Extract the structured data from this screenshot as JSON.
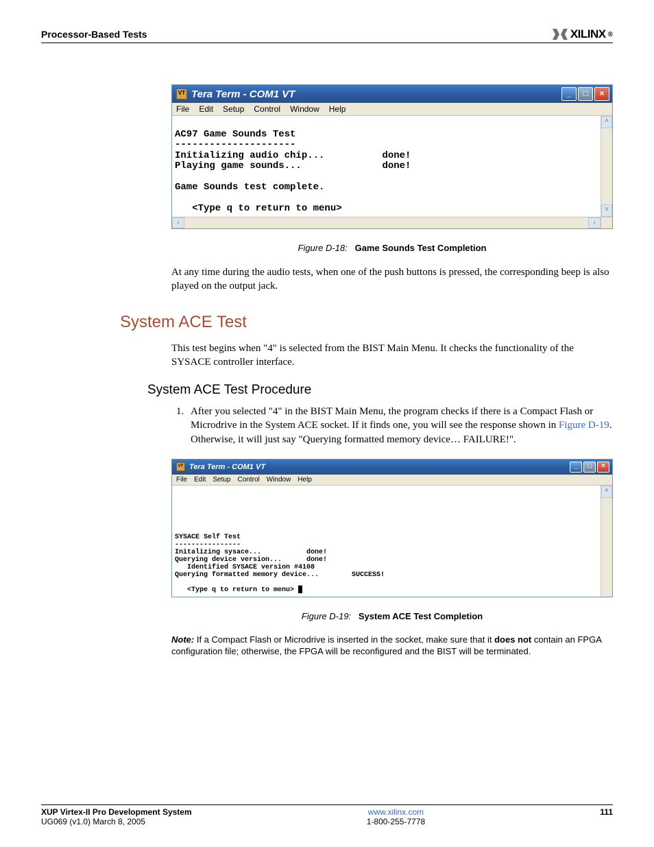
{
  "header": {
    "section_title": "Processor-Based Tests",
    "logo_text": "XILINX",
    "logo_reg": "®"
  },
  "term1": {
    "title": "Tera Term - COM1 VT",
    "menus": [
      "File",
      "Edit",
      "Setup",
      "Control",
      "Window",
      "Help"
    ],
    "body": "AC97 Game Sounds Test\n---------------------\nInitializing audio chip...          done!\nPlaying game sounds...              done!\n\nGame Sounds test complete.\n\n   <Type q to return to menu>"
  },
  "fig1": {
    "prefix": "Figure D-18:",
    "title": "Game Sounds Test Completion"
  },
  "p1": "At any time during the audio tests, when one of the push buttons is pressed, the corresponding beep is also played on the output jack.",
  "h2": "System ACE Test",
  "p2": "This test begins when \"4\" is selected from the BIST Main Menu. It checks the functionality of the SYSACE controller interface.",
  "h3": "System ACE Test Procedure",
  "li1_a": "After you selected \"4\" in the BIST Main Menu, the program checks if there is a Compact Flash or Microdrive in the System ACE socket. If it finds one, you will see the response shown in ",
  "li1_link": "Figure D-19",
  "li1_b": ". Otherwise, it will just say \"Querying formatted memory device… FAILURE!\".",
  "term2": {
    "title": "Tera Term - COM1 VT",
    "menus": [
      "File",
      "Edit",
      "Setup",
      "Control",
      "Window",
      "Help"
    ],
    "body": "SYSACE Self Test\n----------------\nInitalizing sysace...           done!\nQuerying device version...      done!\n   Identified SYSACE version #4108\nQuerying formatted memory device...        SUCCESS!\n\n   <Type q to return to menu> █"
  },
  "fig2": {
    "prefix": "Figure D-19:",
    "title": "System ACE Test Completion"
  },
  "note": {
    "label": "Note:",
    "text_a": "If a Compact Flash or Microdrive is inserted in the socket, make sure that it ",
    "bold": "does not",
    "text_b": " contain an FPGA configuration file; otherwise, the FPGA will be reconfigured and the BIST will be terminated."
  },
  "footer": {
    "left_line1": "XUP  Virtex-II Pro Development System",
    "left_line2": "UG069 (v1.0) March 8, 2005",
    "center_line1": "www.xilinx.com",
    "center_line2": "1-800-255-7778",
    "right": "111"
  }
}
